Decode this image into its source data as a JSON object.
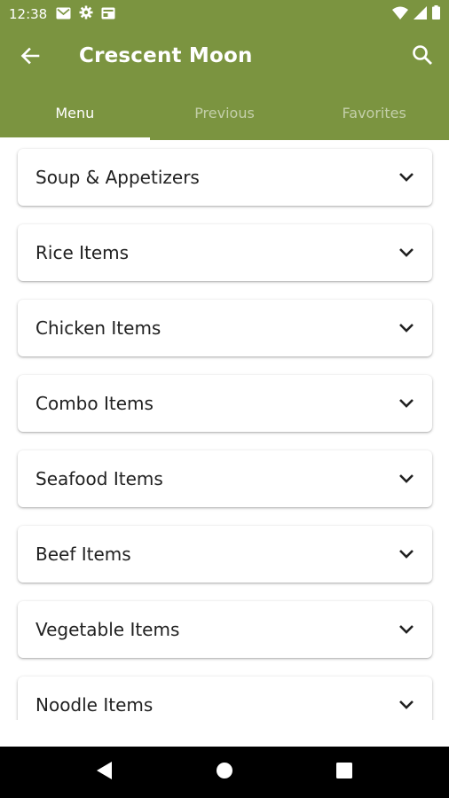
{
  "status_bar": {
    "time": "12:38",
    "icons": [
      "gmail-icon",
      "gear-icon",
      "card-icon",
      "wifi-icon",
      "signal-icon",
      "battery-icon"
    ]
  },
  "app_bar": {
    "title": "Crescent Moon",
    "background_color": "#7b9440"
  },
  "tabs": [
    {
      "label": "Menu",
      "active": true
    },
    {
      "label": "Previous",
      "active": false
    },
    {
      "label": "Favorites",
      "active": false
    }
  ],
  "categories": [
    {
      "label": "Soup & Appetizers"
    },
    {
      "label": "Rice Items"
    },
    {
      "label": "Chicken Items"
    },
    {
      "label": "Combo Items"
    },
    {
      "label": "Seafood Items"
    },
    {
      "label": "Beef Items"
    },
    {
      "label": "Vegetable Items"
    },
    {
      "label": "Noodle Items"
    }
  ],
  "nav_bar": {
    "buttons": [
      "back-icon",
      "home-icon",
      "recents-icon"
    ]
  }
}
